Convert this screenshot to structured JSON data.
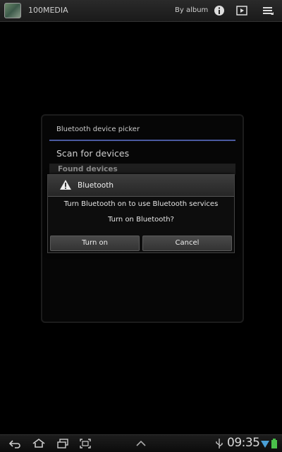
{
  "topbar": {
    "title": "100MEDIA",
    "view_mode": "By album",
    "icons": [
      "gallery-app-icon",
      "info-icon",
      "slideshow-icon",
      "menu-icon"
    ]
  },
  "picker": {
    "title": "Bluetooth device picker",
    "scan_label": "Scan for devices",
    "found_label": "Found devices"
  },
  "alert": {
    "title": "Bluetooth",
    "message": "Turn Bluetooth on to use Bluetooth services",
    "question": "Turn on Bluetooth?",
    "turn_on_label": "Turn on",
    "cancel_label": "Cancel"
  },
  "statusbar": {
    "time": "09:35"
  },
  "colors": {
    "accent": "#4a5aa0"
  }
}
